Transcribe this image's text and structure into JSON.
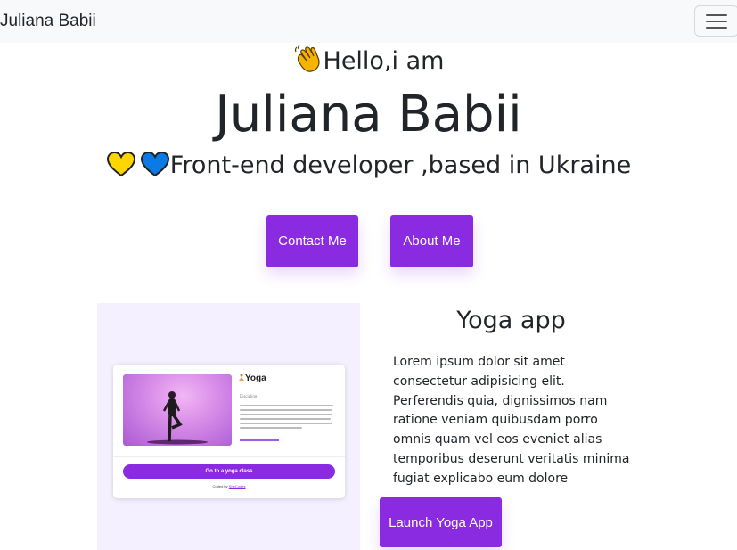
{
  "navbar": {
    "brand": "Juliana Babii",
    "toggler_icon": "hamburger-menu-icon"
  },
  "hero": {
    "greeting_icon": "waving-hand-icon",
    "greeting": "Hello,i am",
    "name": "Juliana Babii",
    "hearts": [
      {
        "icon": "yellow-heart-icon",
        "color": "#ffd500"
      },
      {
        "icon": "blue-heart-icon",
        "color": "#0a7ae6"
      }
    ],
    "tagline": "Front-end developer ,based in Ukraine",
    "buttons": {
      "contact": "Contact Me",
      "about": "About Me"
    }
  },
  "project": {
    "title": "Yoga app",
    "description": "Lorem ipsum dolor sit amet consectetur adipisicing elit. Perferendis quia, dignissimos nam ratione veniam quibusdam porro omnis quam vel eos eveniet alias temporibus deserunt veritatis minima fugiat explicabo eum dolore",
    "launch_button": "Launch Yoga App",
    "preview": {
      "title_icon": "yoga-icon",
      "title": "Yoga",
      "subtitle": "Discipline",
      "button": "Go to a yoga class",
      "footer_prefix": "Coded by",
      "footer_link": "SheCodes"
    }
  },
  "colors": {
    "accent": "#8a2be2",
    "navbar_bg": "#f8f9fa",
    "preview_bg": "#f4f0ff",
    "text": "#212529"
  }
}
